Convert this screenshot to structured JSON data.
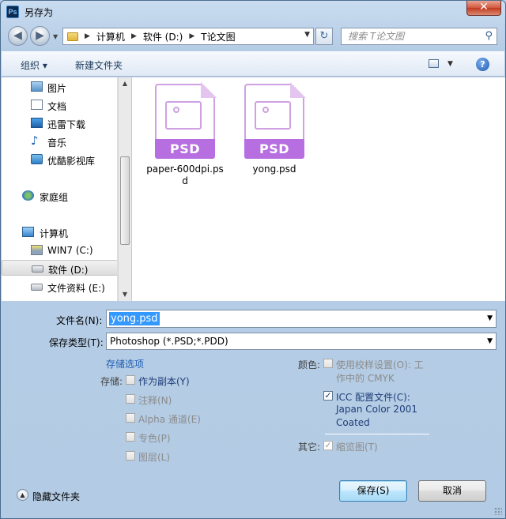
{
  "window": {
    "title": "另存为",
    "app_icon": "ps-icon",
    "close_label": "✕"
  },
  "address": {
    "crumbs": [
      "计算机",
      "软件 (D:)",
      "T论文图"
    ],
    "search_placeholder": "搜索 T论文图"
  },
  "toolbar": {
    "organize": "组织 ▾",
    "new_folder": "新建文件夹",
    "help": "?"
  },
  "nav_pane": {
    "items": [
      {
        "label": "图片",
        "icon": "pictures-icon"
      },
      {
        "label": "文档",
        "icon": "documents-icon"
      },
      {
        "label": "迅雷下载",
        "icon": "thunder-download-icon"
      },
      {
        "label": "音乐",
        "icon": "music-icon"
      },
      {
        "label": "优酷影视库",
        "icon": "video-library-icon"
      },
      {
        "label": "家庭组",
        "icon": "homegroup-icon"
      },
      {
        "label": "计算机",
        "icon": "computer-icon"
      },
      {
        "label": "WIN7 (C:)",
        "icon": "drive-c-icon"
      },
      {
        "label": "软件 (D:)",
        "icon": "drive-icon",
        "selected": true
      },
      {
        "label": "文件资料 (E:)",
        "icon": "drive-icon"
      }
    ]
  },
  "files": [
    {
      "name": "paper-600dpi.psd",
      "badge": "PSD"
    },
    {
      "name": "yong.psd",
      "badge": "PSD"
    }
  ],
  "form": {
    "filename_label": "文件名(N):",
    "filename_value": "yong.psd",
    "filetype_label": "保存类型(T):",
    "filetype_value": "Photoshop (*.PSD;*.PDD)",
    "save_options_link": "存储选项",
    "storage_label": "存储:",
    "options": [
      {
        "label": "作为副本(Y)",
        "checked": false,
        "enabled": true
      },
      {
        "label": "注释(N)",
        "checked": false,
        "enabled": false
      },
      {
        "label": "Alpha 通道(E)",
        "checked": false,
        "enabled": false
      },
      {
        "label": "专色(P)",
        "checked": false,
        "enabled": false
      },
      {
        "label": "图层(L)",
        "checked": false,
        "enabled": false
      }
    ],
    "color_label": "颜色:",
    "proof_setup": {
      "line1": "使用校样设置(O):  工",
      "line2": "作中的 CMYK",
      "checked": false
    },
    "icc_profile": {
      "line1": "ICC 配置文件(C):",
      "line2": "Japan Color 2001",
      "line3": "Coated",
      "checked": true
    },
    "other_label": "其它:",
    "thumbnail": {
      "label": "缩览图(T)",
      "checked": true
    }
  },
  "footer": {
    "hide_folders": "隐藏文件夹",
    "save_button": "保存(S)",
    "cancel_button": "取消"
  },
  "colors": {
    "selection": "#3399ff",
    "psd_badge": "#b66ee0",
    "link": "#1f5fb4"
  }
}
